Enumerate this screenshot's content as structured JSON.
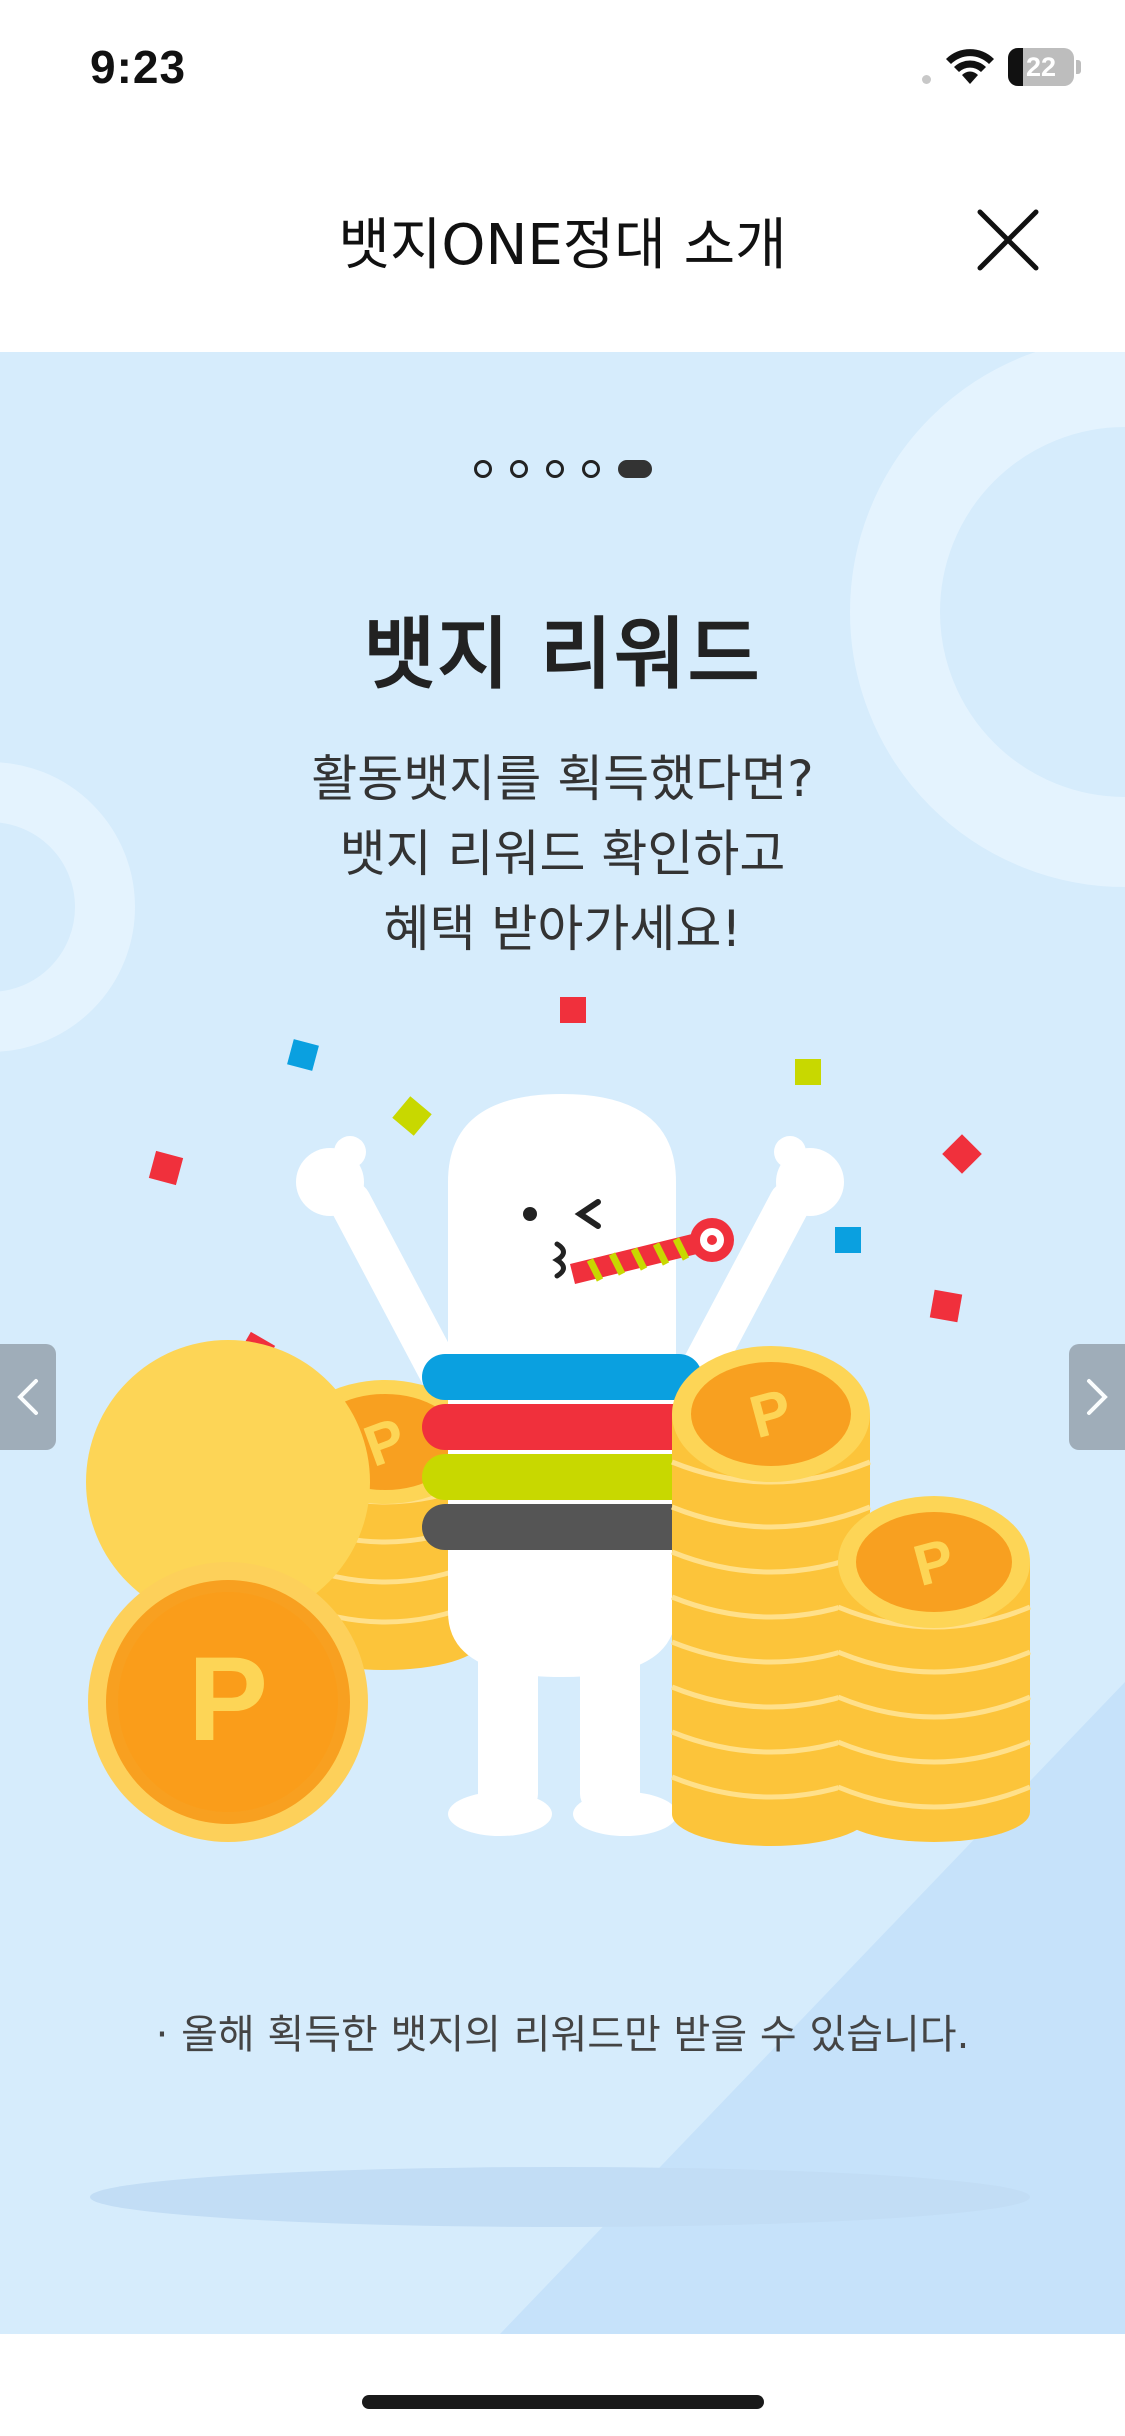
{
  "status_bar": {
    "time": "9:23",
    "battery_text": "22",
    "battery_level_percent": 22
  },
  "header": {
    "title": "뱃지ONE정대 소개",
    "close_icon": "close-icon"
  },
  "slide": {
    "page_count": 5,
    "active_page": 5,
    "title": "뱃지 리워드",
    "description_lines": [
      "활동뱃지를 획득했다면?",
      "뱃지 리워드 확인하고",
      "혜택 받아가세요!"
    ],
    "note": "· 올해 획득한 뱃지의 리워드만 받을 수 있습니다.",
    "coin_letter": "P"
  },
  "nav": {
    "prev_icon": "chevron-left-icon",
    "next_icon": "chevron-right-icon"
  },
  "colors": {
    "background": "#d6ecfc",
    "band_blue": "#0aa0e0",
    "band_red": "#f0303c",
    "band_lime": "#c8d800",
    "band_gray": "#555555",
    "coin_orange": "#f8a020",
    "coin_gold": "#ffc83c"
  }
}
